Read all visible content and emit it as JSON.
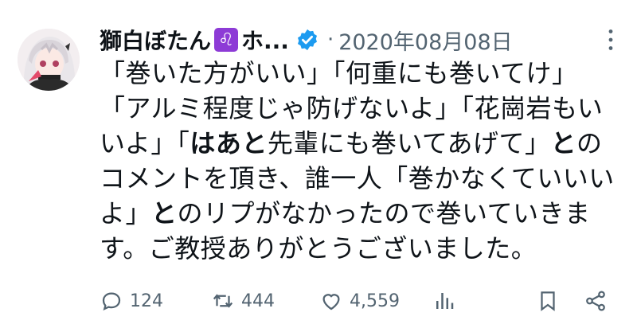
{
  "author": {
    "name": "獅白ぼたん",
    "name_tail": "ホ...",
    "zodiac_glyph": "♌",
    "verified": true
  },
  "meta": {
    "separator": "·",
    "date": "2020年08月08日"
  },
  "body": {
    "line1": "「巻いた方がいい」「何重にも巻いてけ」",
    "line2": "「アルミ程度じゃ防げないよ」「花崗岩もい",
    "line3a": "いよ」「",
    "line3b": "はあと",
    "line3c": "先輩にも巻いてあげて」",
    "line3d": "と",
    "line3e": "の",
    "line4": "コメントを頂き、誰一人「巻かなくていいい",
    "line5a": "よ」",
    "line5b": "と",
    "line5c": "のリプがなかったので巻いていきま",
    "line6": "す。ご教授ありがとうございました。"
  },
  "actions": {
    "reply_count": "124",
    "retweet_count": "444",
    "like_count": "4,559"
  },
  "colors": {
    "text": "#0f1419",
    "muted": "#536471",
    "verified": "#1d9bf0",
    "zodiac_bg": "#8d3bd6"
  }
}
